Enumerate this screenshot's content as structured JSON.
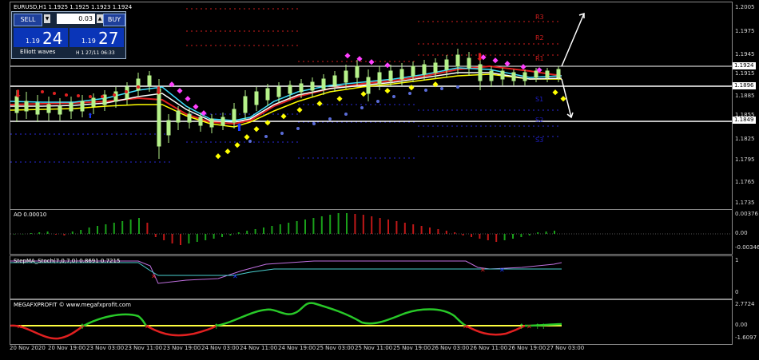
{
  "symbol_header": "EURUSD,H1  1.1925 1.1925 1.1923 1.1924",
  "trade_panel": {
    "sell_label": "SELL",
    "buy_label": "BUY",
    "lot": "0.03",
    "sell_small": "1.19",
    "sell_big": "24",
    "buy_small": "1.19",
    "buy_big": "27",
    "caption": "Elliott waves",
    "timeframe": "H 1 27/11 06:33"
  },
  "price_axis": [
    "1.2005",
    "1.1975",
    "1.1945",
    "1.1915",
    "1.1885",
    "1.1855",
    "1.1825",
    "1.1795",
    "1.1765",
    "1.1735"
  ],
  "price_tags": {
    "current": "1.1924",
    "high_line": "1.1896",
    "low_line": "1.1849"
  },
  "pivot_levels": {
    "r3": "R3",
    "r2": "R2",
    "r1": "R1",
    "s1": "S1",
    "s2": "S2",
    "s3": "S3"
  },
  "ao_panel": {
    "title": "AO 0.00010",
    "axis_top": "0.00376",
    "axis_mid": "0.00",
    "axis_bottom": "-0.00346"
  },
  "stoch_panel": {
    "title": "StepMA_Stoch(7,0,7,0) 0.8691 0.7215",
    "axis_top": "1",
    "axis_bottom": "0"
  },
  "mega_panel": {
    "title": "MEGAFXPROFIT © www.megafxprofit.com",
    "axis_top": "2.7724",
    "axis_mid": "0.00",
    "axis_bottom": "-1.6097"
  },
  "time_axis": [
    "20 Nov 2020",
    "20 Nov 19:00",
    "23 Nov 03:00",
    "23 Nov 11:00",
    "23 Nov 19:00",
    "24 Nov 03:00",
    "24 Nov 11:00",
    "24 Nov 19:00",
    "25 Nov 03:00",
    "25 Nov 11:00",
    "25 Nov 19:00",
    "26 Nov 03:00",
    "26 Nov 11:00",
    "26 Nov 19:00",
    "27 Nov 03:00"
  ],
  "colors": {
    "candle_up": "#b6f28a",
    "candle_down": "#b6f28a",
    "pivot_red": "#d21e1e",
    "pivot_blue": "#1e1ec8",
    "ma_yellow": "#ffff00",
    "ma_cyan": "#40e0ff",
    "ma_white": "#ffffff",
    "ma_red": "#e02020",
    "dots_magenta": "#ff40ff",
    "dots_yellow": "#ffff00",
    "dots_blue": "#5a6cd8",
    "ao_green": "#1aa01a",
    "ao_red": "#c01818",
    "stoch_violet": "#c070e0",
    "stoch_cyan": "#4ad0d0",
    "mega_green": "#28c828",
    "mega_red": "#e02020",
    "mega_zero": "#ffff40"
  }
}
